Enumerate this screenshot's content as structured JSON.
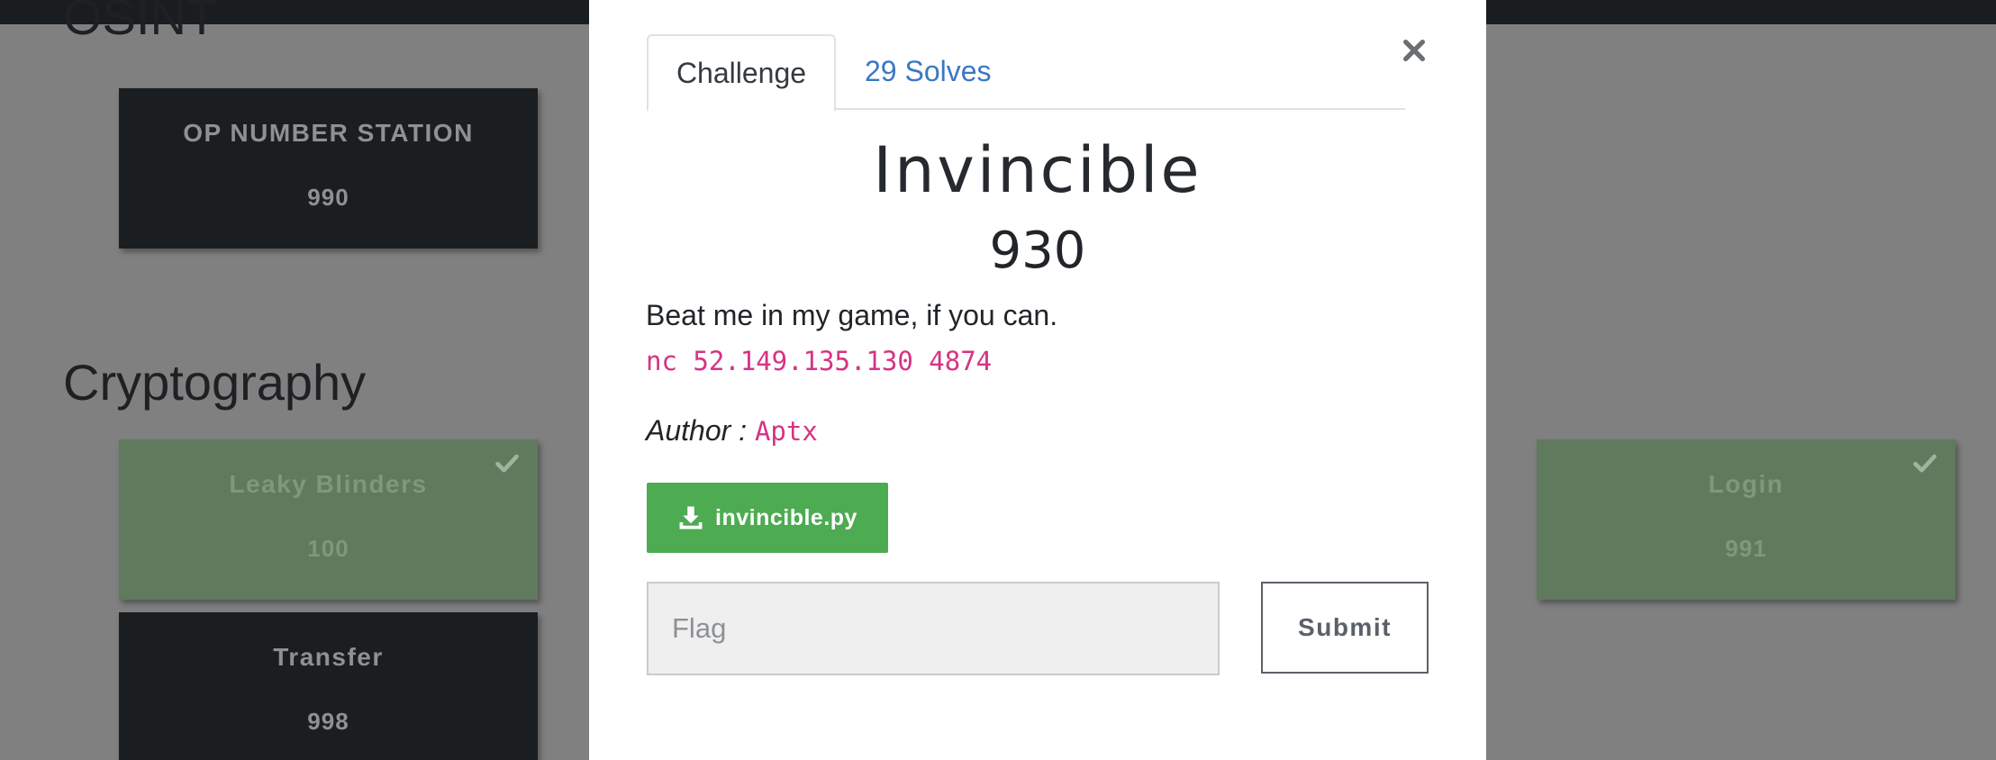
{
  "background": {
    "categories": [
      {
        "name": "OSINT",
        "challenges": [
          {
            "name": "OP NUMBER STATION",
            "value": "990",
            "solved": false
          }
        ]
      },
      {
        "name": "Cryptography",
        "challenges": [
          {
            "name": "Leaky Blinders",
            "value": "100",
            "solved": true
          },
          {
            "name": "Login",
            "value": "991",
            "solved": true
          },
          {
            "name": "Transfer",
            "value": "998",
            "solved": false
          }
        ]
      }
    ]
  },
  "modal": {
    "tabs": [
      {
        "label": "Challenge",
        "active": true
      },
      {
        "label": "29 Solves",
        "active": false
      }
    ],
    "title": "Invincible",
    "points": "930",
    "description": "Beat me in my game, if you can.",
    "connection": "nc 52.149.135.130 4874",
    "author_label": "Author :",
    "author_name": "Aptx",
    "file_button_label": "invincible.py",
    "flag_placeholder": "Flag",
    "submit_label": "Submit",
    "icons": {
      "close": "close-icon",
      "download": "download-icon",
      "solved": "check-icon"
    },
    "colors": {
      "file_button": "#4dab52",
      "code_text": "#d63384",
      "solves_link": "#3a78c2",
      "solved_card": "#5f7a5c",
      "unsolved_card": "#1b1e21"
    }
  }
}
